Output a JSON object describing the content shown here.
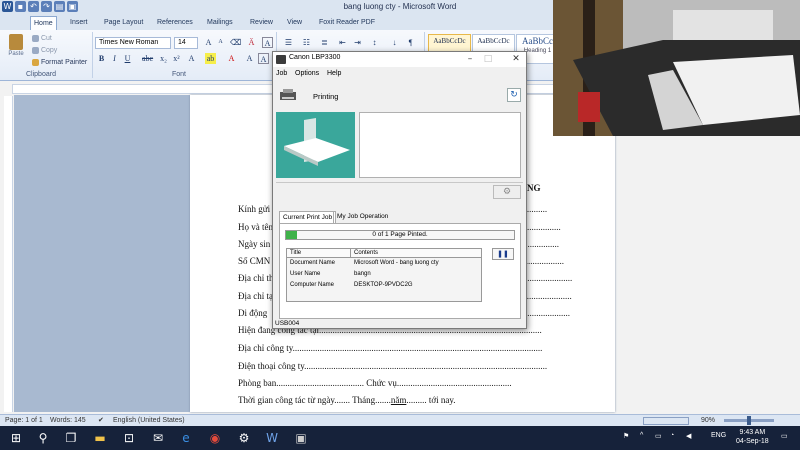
{
  "word": {
    "window_title": "bang luong cty - Microsoft Word",
    "tabs": [
      "Home",
      "Insert",
      "Page Layout",
      "References",
      "Mailings",
      "Review",
      "View",
      "Foxit Reader PDF"
    ],
    "clipboard": {
      "paste": "Paste",
      "cut": "Cut",
      "copy": "Copy",
      "format_painter": "Format Painter",
      "group": "Clipboard"
    },
    "font": {
      "name": "Times New Roman",
      "size": "14",
      "group": "Font"
    },
    "styles": [
      {
        "sample": "AaBbCcDc",
        "name": ""
      },
      {
        "sample": "AaBbCcDc",
        "name": ""
      },
      {
        "sample": "AaBbCc",
        "name": "Heading 1"
      }
    ],
    "document": {
      "title_fragment": "NG",
      "lines": [
        {
          "label": "Kính gửi",
          "dots": "...................."
        },
        {
          "label": "Họ và tên",
          "dots": "..................................."
        },
        {
          "label": "Ngày sin",
          "dots": "..................................."
        },
        {
          "label": "Số CMN",
          "dots": "..................................."
        },
        {
          "label": "Địa chỉ th",
          "dots": "..................................."
        },
        {
          "label": "Địa chỉ tạ",
          "dots": "..................................."
        },
        {
          "label": "Di động",
          "dots": "..................................."
        },
        {
          "label": "Hiện đang công tác tại",
          "dots": "..................................................................................................."
        },
        {
          "label": "Địa chỉ công ty",
          "dots": "..............................................................................................................."
        },
        {
          "label": "Điện thoại công ty",
          "dots": "............................................................................................................"
        },
        {
          "label": "Phòng ban",
          "dots": ".......................................",
          "label2": "Chức vụ",
          "dots2": "..................................................."
        },
        {
          "label": "Thời gian công tác từ ngày",
          "dots": ".......",
          "label2": "Tháng",
          "dots2": ".......",
          "label3": "năm",
          "dots3": ".........",
          "label4": "tới nay."
        }
      ]
    },
    "status": {
      "page": "Page: 1 of 1",
      "words": "Words: 145",
      "language": "English (United States)",
      "zoom": "90%"
    }
  },
  "dialog": {
    "title": "Canon LBP3300",
    "menu": [
      "Job",
      "Options",
      "Help"
    ],
    "status": "Printing",
    "tabs": [
      "Current Print Job",
      "My Job Operation"
    ],
    "progress_text": "0 of 1 Page Pinted.",
    "progress_fraction": 0.05,
    "table_headers": [
      "Title",
      "Contents"
    ],
    "rows": [
      {
        "title": "Document Name",
        "contents": "Microsoft Word - bang luong cty"
      },
      {
        "title": "User Name",
        "contents": "bangn"
      },
      {
        "title": "Computer Name",
        "contents": "DESKTOP-9PVDC2G"
      }
    ],
    "port": "USB004"
  },
  "taskbar": {
    "language": "ENG",
    "time": "9:43 AM",
    "date": "04-Sep-18"
  },
  "colors": {
    "ribbon_bg": "#dbe5f1",
    "taskbar_bg": "#16223a",
    "animation_teal": "#3aa79b",
    "progress_green": "#3fb24a"
  }
}
